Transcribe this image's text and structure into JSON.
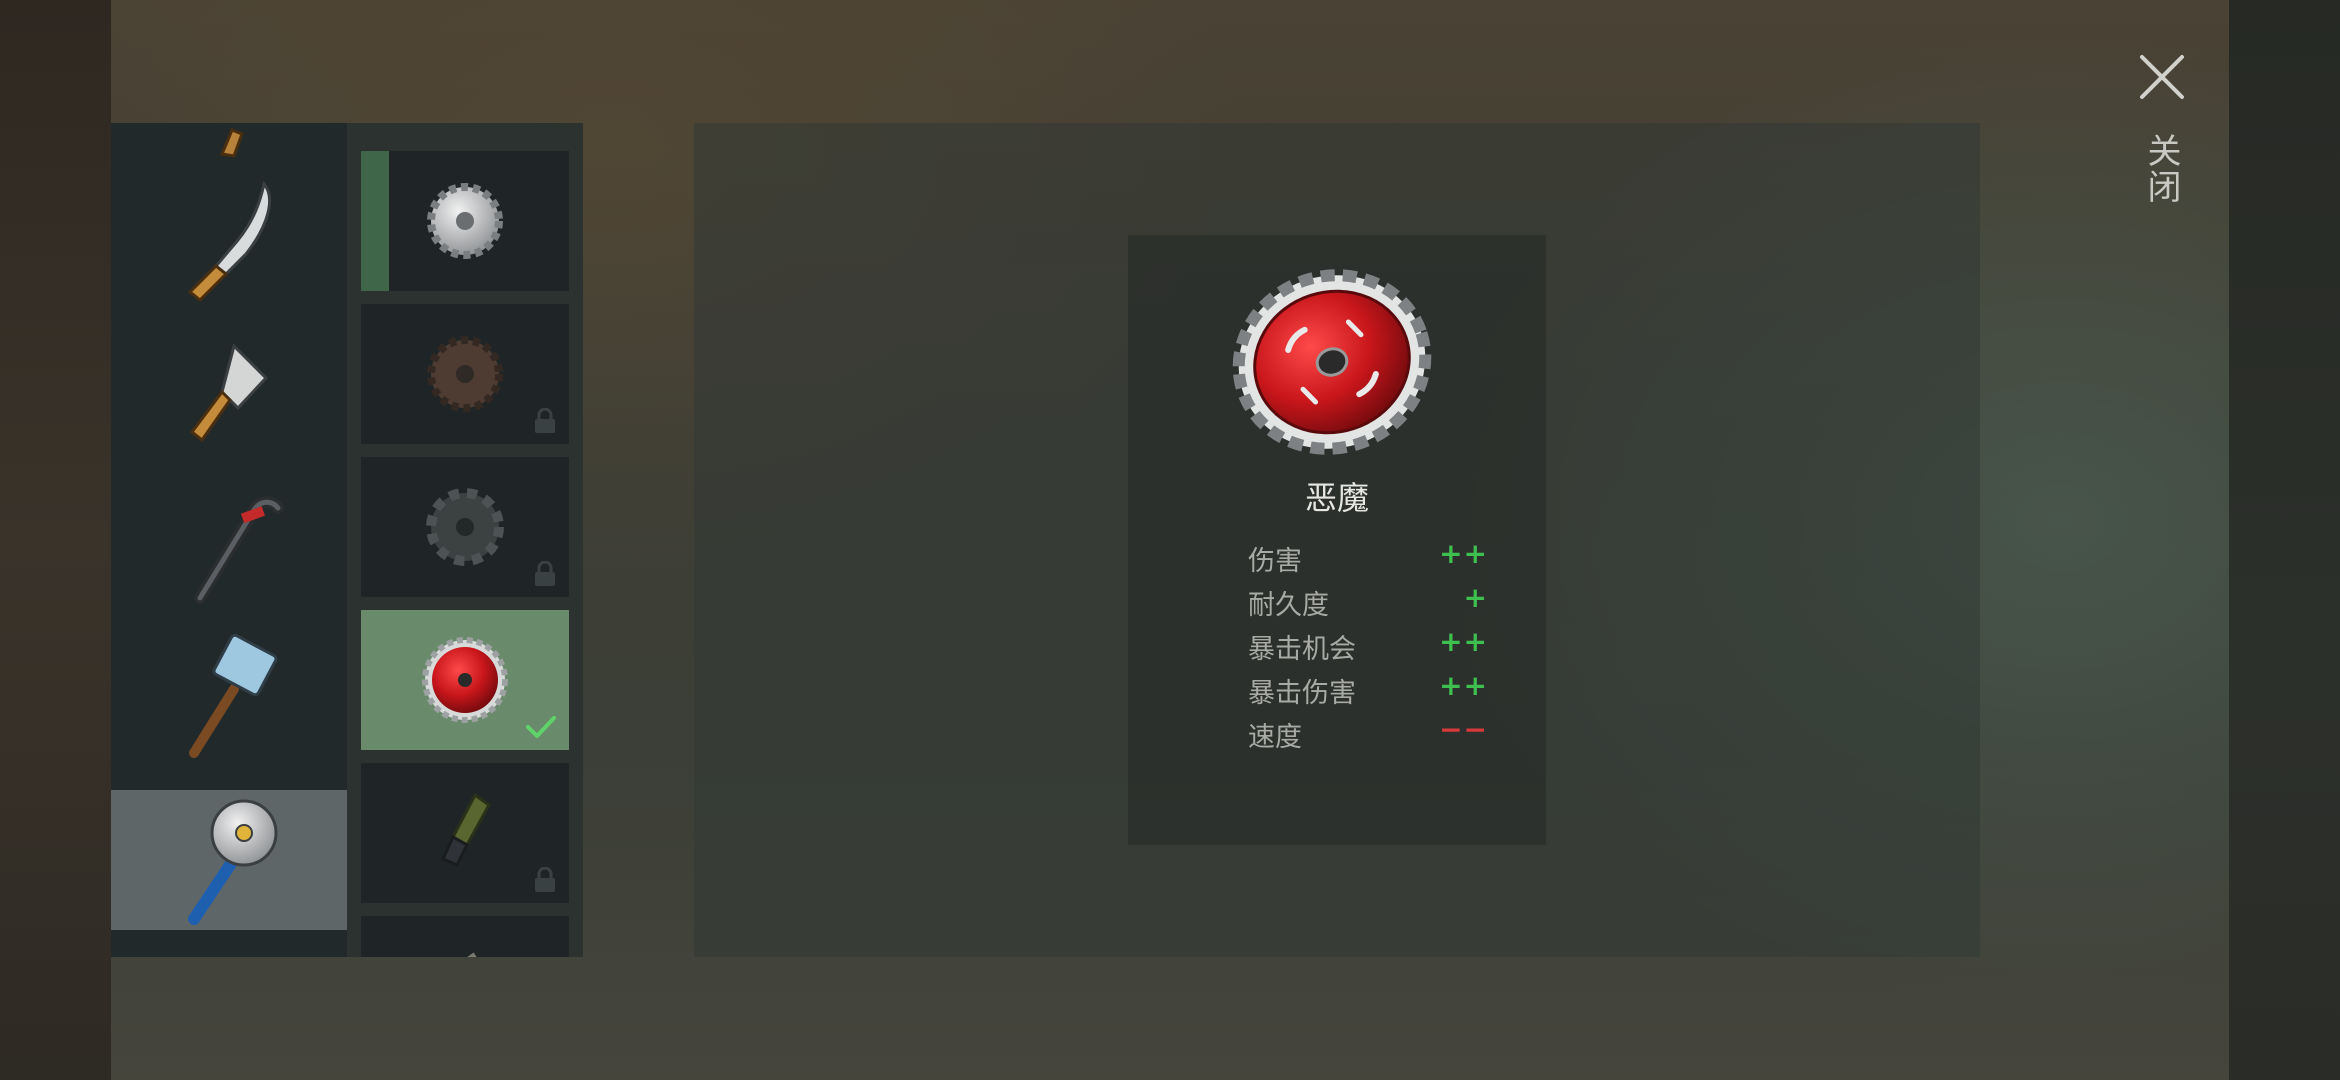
{
  "close": {
    "label": "关闭",
    "icon": "close-icon"
  },
  "colors": {
    "positive": "#3fbf4f",
    "negative": "#d63a3a",
    "equipped_bg": "#6a8a6c",
    "check": "#5fd36a"
  },
  "weapons": [
    {
      "name": "knife-partial",
      "icon": "knife-icon",
      "selected": false
    },
    {
      "name": "machete",
      "icon": "machete-icon",
      "selected": false
    },
    {
      "name": "cleaver",
      "icon": "cleaver-icon",
      "selected": false
    },
    {
      "name": "crowbar",
      "icon": "crowbar-icon",
      "selected": false
    },
    {
      "name": "sledgehammer",
      "icon": "sledgehammer-icon",
      "selected": false
    },
    {
      "name": "saw-blade-mace",
      "icon": "sawblade-mace-icon",
      "selected": true
    }
  ],
  "skins": [
    {
      "icon": "silver-sawblade-icon",
      "locked": false,
      "equipped": false,
      "marked": true
    },
    {
      "icon": "rusty-sawblade-icon",
      "locked": true,
      "equipped": false,
      "marked": false
    },
    {
      "icon": "dark-gear-icon",
      "locked": true,
      "equipped": false,
      "marked": false
    },
    {
      "icon": "red-sawblade-icon",
      "locked": false,
      "equipped": true,
      "marked": false
    },
    {
      "icon": "grenade-icon",
      "locked": true,
      "equipped": false,
      "marked": false
    },
    {
      "icon": "partial-item-icon",
      "locked": false,
      "equipped": false,
      "marked": false
    }
  ],
  "detail": {
    "name": "恶魔",
    "stats": [
      {
        "label": "伤害",
        "value": "++",
        "polarity": "positive"
      },
      {
        "label": "耐久度",
        "value": "+",
        "polarity": "positive"
      },
      {
        "label": "暴击机会",
        "value": "++",
        "polarity": "positive"
      },
      {
        "label": "暴击伤害",
        "value": "++",
        "polarity": "positive"
      },
      {
        "label": "速度",
        "value": "−−",
        "polarity": "negative"
      }
    ]
  }
}
